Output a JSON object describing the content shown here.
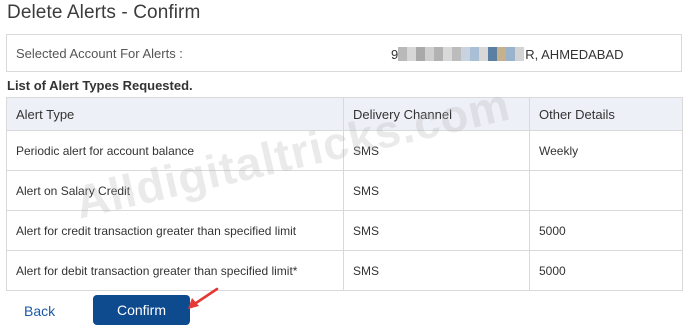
{
  "page": {
    "title": "Delete Alerts - Confirm"
  },
  "account": {
    "label": "Selected Account For Alerts :",
    "value_prefix": "9",
    "value_suffix": "R, AHMEDABAD",
    "mask_colors": [
      "#b9b9b9",
      "#d7d7d7",
      "#a9a9a9",
      "#cfcfcf",
      "#b2b2b2",
      "#d9d9d9",
      "#bcbcbc",
      "#c9d3e0",
      "#a8bfd6",
      "#d8d8d8",
      "#5b7fa3",
      "#c7b08e",
      "#9ab3cc",
      "#d3d3d3"
    ]
  },
  "list": {
    "heading": "List of Alert Types Requested."
  },
  "table": {
    "headers": [
      "Alert Type",
      "Delivery Channel",
      "Other Details"
    ],
    "rows": [
      [
        "Periodic alert for account balance",
        "SMS",
        "Weekly"
      ],
      [
        "Alert on Salary Credit",
        "SMS",
        ""
      ],
      [
        "Alert for credit transaction greater than specified limit",
        "SMS",
        "5000"
      ],
      [
        "Alert for debit transaction greater than specified limit*",
        "SMS",
        "5000"
      ]
    ]
  },
  "watermark": {
    "text": "Alldigitaltricks.com"
  },
  "actions": {
    "back_label": "Back",
    "confirm_label": "Confirm"
  },
  "colors": {
    "primary_button": "#0e4a8e",
    "link": "#1b5aa6",
    "header_bg": "#eef0f8",
    "arrow": "#e53935"
  },
  "icons": {
    "arrow": "red-arrow-icon"
  }
}
